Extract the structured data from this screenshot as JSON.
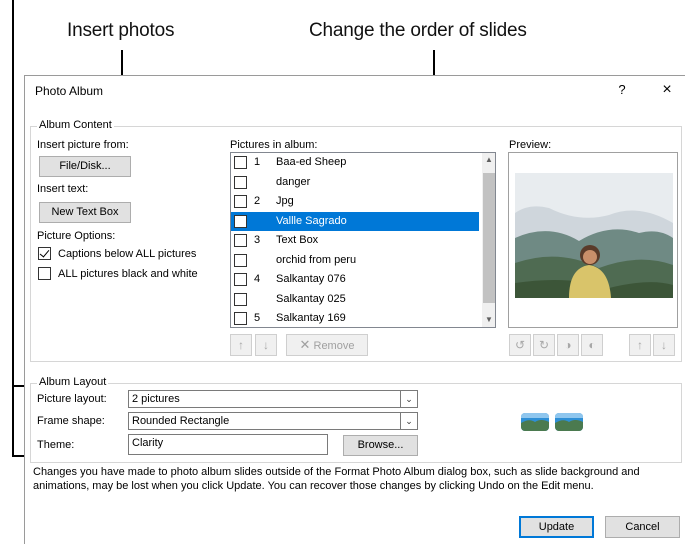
{
  "callouts": {
    "insert_photos": "Insert photos",
    "change_order": "Change the order of slides"
  },
  "dialog": {
    "title": "Photo Album",
    "help": "?",
    "close": "×"
  },
  "album_content": {
    "label": "Album Content",
    "insert_picture_from_label": "Insert picture from:",
    "file_disk_button": "File/Disk...",
    "insert_text_label": "Insert text:",
    "new_text_box_button": "New Text Box",
    "picture_options_label": "Picture Options:",
    "options": [
      {
        "label": "Captions below ALL pictures",
        "checked": true
      },
      {
        "label": "ALL pictures black and white",
        "checked": false
      }
    ]
  },
  "pictures": {
    "label": "Pictures in album:",
    "items": [
      {
        "num": "1",
        "name": "Baa-ed Sheep",
        "selected": false
      },
      {
        "num": "",
        "name": "danger",
        "selected": false
      },
      {
        "num": "2",
        "name": "Jpg",
        "selected": false
      },
      {
        "num": "",
        "name": "Vallle Sagrado",
        "selected": true
      },
      {
        "num": "3",
        "name": "Text Box",
        "selected": false
      },
      {
        "num": "",
        "name": "orchid from peru",
        "selected": false
      },
      {
        "num": "4",
        "name": "Salkantay 076",
        "selected": false
      },
      {
        "num": "",
        "name": "Salkantay 025",
        "selected": false
      },
      {
        "num": "5",
        "name": "Salkantay 169",
        "selected": false
      }
    ],
    "move_up": "↑",
    "move_down": "↓",
    "remove_button": "Remove",
    "remove_icon": "✕"
  },
  "preview": {
    "label": "Preview:",
    "tools": [
      "↺",
      "↻",
      "◑",
      "◐",
      "↑",
      "↓"
    ]
  },
  "album_layout": {
    "label": "Album Layout",
    "picture_layout_label": "Picture layout:",
    "picture_layout_value": "2 pictures",
    "frame_shape_label": "Frame shape:",
    "frame_shape_value": "Rounded Rectangle",
    "theme_label": "Theme:",
    "theme_value": "Clarity",
    "browse_button": "Browse..."
  },
  "info_text": "Changes you have made to photo album slides outside of the Format Photo Album dialog box, such as slide background and animations, may be lost when you click Update. You can recover those changes by clicking Undo on the Edit menu.",
  "footer": {
    "update_button": "Update",
    "cancel_button": "Cancel"
  },
  "colors": {
    "selection": "#0078d7",
    "button_face": "#e1e1e1"
  }
}
